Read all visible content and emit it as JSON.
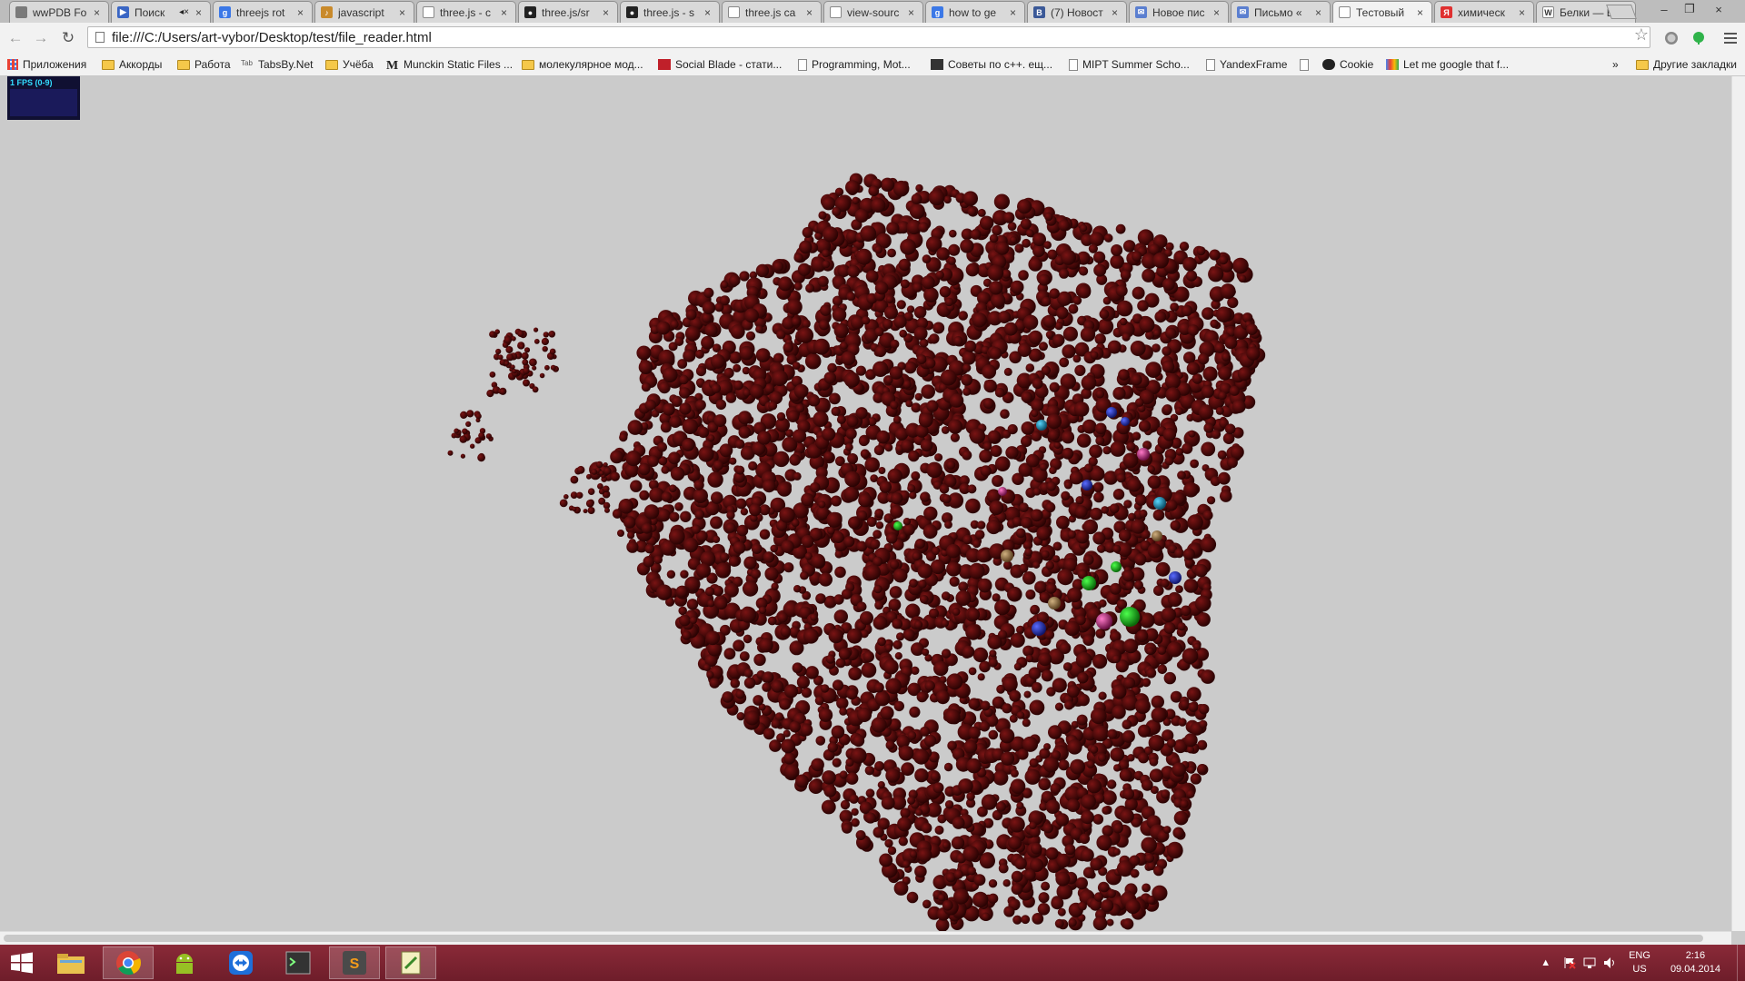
{
  "browser": {
    "tabs": [
      {
        "title": "wwPDB Fo",
        "icon_color": "#7a7a7a",
        "icon_glyph": ""
      },
      {
        "title": "Поиск",
        "icon_color": "#3a66c4",
        "icon_glyph": "▶",
        "muted_icon": "◂×"
      },
      {
        "title": "threejs rot",
        "icon_color": "#3b78e7",
        "icon_glyph": "g"
      },
      {
        "title": "javascript",
        "icon_color": "#c98a2b",
        "icon_glyph": "♪"
      },
      {
        "title": "three.js - c",
        "icon_color": "#ffffff",
        "icon_glyph": ""
      },
      {
        "title": "three.js/sr",
        "icon_color": "#222222",
        "icon_glyph": "●"
      },
      {
        "title": "three.js - s",
        "icon_color": "#222222",
        "icon_glyph": "●"
      },
      {
        "title": "three.js ca",
        "icon_color": "#ffffff",
        "icon_glyph": ""
      },
      {
        "title": "view-sourc",
        "icon_color": "#ffffff",
        "icon_glyph": ""
      },
      {
        "title": "how to ge",
        "icon_color": "#3b78e7",
        "icon_glyph": "g"
      },
      {
        "title": "(7) Новост",
        "icon_color": "#3b5998",
        "icon_glyph": "B"
      },
      {
        "title": "Новое пис",
        "icon_color": "#5b7fd0",
        "icon_glyph": "✉"
      },
      {
        "title": "Письмо «",
        "icon_color": "#5b7fd0",
        "icon_glyph": "✉"
      },
      {
        "title": "Тестовый",
        "icon_color": "#ffffff",
        "icon_glyph": "",
        "active": true
      },
      {
        "title": "химическ",
        "icon_color": "#e03030",
        "icon_glyph": "Я"
      },
      {
        "title": "Белки — В",
        "icon_color": "#ffffff",
        "icon_glyph": "W"
      }
    ],
    "close_glyph": "×",
    "window_controls": {
      "minimize": "–",
      "restore": "❐",
      "close": "×"
    },
    "nav": {
      "back": "←",
      "forward": "→",
      "reload": "↻"
    },
    "url": "file:///C:/Users/art-vybor/Desktop/test/file_reader.html",
    "bookmark_star": "☆",
    "bookmarks": [
      {
        "label": "Приложения",
        "type": "apps"
      },
      {
        "label": "Аккорды",
        "type": "folder"
      },
      {
        "label": "Работа",
        "type": "folder"
      },
      {
        "label": "TabsBy.Net",
        "type": "tabs"
      },
      {
        "label": "Учёба",
        "type": "folder"
      },
      {
        "label": "Munckin Static Files ...",
        "type": "munchkin"
      },
      {
        "label": "молекулярное мод...",
        "type": "folder"
      },
      {
        "label": "Social Blade - стати...",
        "type": "socialblade"
      },
      {
        "label": "Programming, Mot...",
        "type": "page"
      },
      {
        "label": "Советы по c++. ещ...",
        "type": "dark"
      },
      {
        "label": "MIPT Summer Scho...",
        "type": "page"
      },
      {
        "label": "YandexFrame",
        "type": "page"
      },
      {
        "label": "",
        "type": "page"
      },
      {
        "label": "Cookie",
        "type": "cookie"
      },
      {
        "label": "Let me google that f...",
        "type": "lmgtfy"
      }
    ],
    "bookmarks_more": "»",
    "other_bookmarks": "Другие закладки"
  },
  "page": {
    "stats_text": "1 FPS (0-9)"
  },
  "taskbar": {
    "apps": [
      "windows-explorer",
      "chrome",
      "android-studio",
      "teamviewer",
      "console",
      "sublime-text",
      "notepad"
    ],
    "tray": {
      "show_hidden": "▲",
      "lang_top": "ENG",
      "lang_bottom": "US",
      "time": "2:16",
      "date": "09.04.2014"
    }
  },
  "colors": {
    "atom_main": "#5a0a0a",
    "background": "#cbcbcb",
    "taskbar": "#7a2330"
  }
}
